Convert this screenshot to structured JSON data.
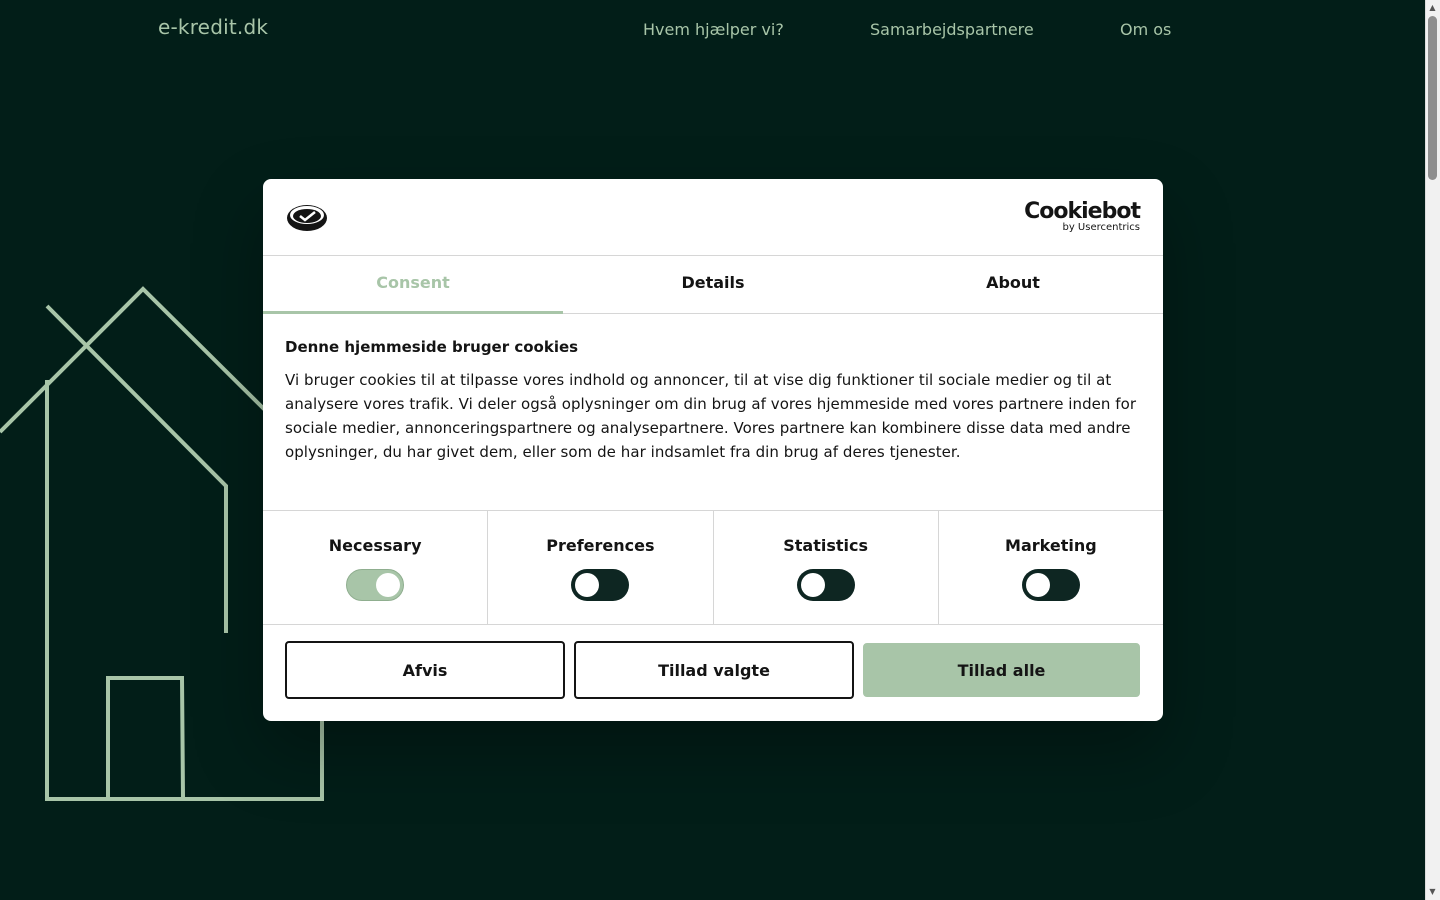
{
  "header": {
    "logo": "e-kredit.dk",
    "nav": [
      "Hvem hjælper vi?",
      "Samarbejdspartnere",
      "Om os"
    ]
  },
  "dialog": {
    "branding": {
      "cookiebot": "Cookiebot",
      "by": "by Usercentrics"
    },
    "tabs": [
      {
        "label": "Consent",
        "active": true
      },
      {
        "label": "Details",
        "active": false
      },
      {
        "label": "About",
        "active": false
      }
    ],
    "title": "Denne hjemmeside bruger cookies",
    "text": "Vi bruger cookies til at tilpasse vores indhold og annoncer, til at vise dig funktioner til sociale medier og til at analysere vores trafik. Vi deler også oplysninger om din brug af vores hjemmeside med vores partnere inden for sociale medier, annonceringspartnere og analysepartnere. Vores partnere kan kombinere disse data med andre oplysninger, du har givet dem, eller som de har indsamlet fra din brug af deres tjenester.",
    "toggles": [
      {
        "label": "Necessary",
        "on": true
      },
      {
        "label": "Preferences",
        "on": false
      },
      {
        "label": "Statistics",
        "on": false
      },
      {
        "label": "Marketing",
        "on": false
      }
    ],
    "buttons": {
      "deny": "Afvis",
      "allow_selected": "Tillad valgte",
      "allow_all": "Tillad alle"
    }
  },
  "colors": {
    "background": "#021e18",
    "accent": "#a8c5a8",
    "switch_off": "#0e2622"
  },
  "icons": {
    "site_logo": "pill-check-icon",
    "scroll_up": "triangle-up-icon",
    "scroll_down": "triangle-down-icon"
  }
}
